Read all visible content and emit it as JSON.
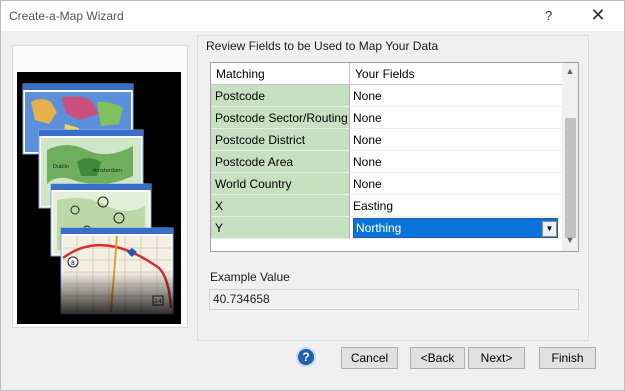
{
  "window": {
    "title": "Create-a-Map Wizard",
    "help_glyph": "?",
    "close_glyph": "✕"
  },
  "panel": {
    "section_title": "Review Fields to be Used to Map Your Data",
    "columns": [
      "Matching",
      "Your Fields"
    ],
    "rows": [
      {
        "matching": "Postcode",
        "field": "None"
      },
      {
        "matching": "Postcode Sector/Routing",
        "field": "None"
      },
      {
        "matching": "Postcode District",
        "field": "None"
      },
      {
        "matching": "Postcode Area",
        "field": "None"
      },
      {
        "matching": "World Country",
        "field": "None"
      },
      {
        "matching": "X",
        "field": "Easting"
      },
      {
        "matching": "Y",
        "field": "Northing"
      }
    ],
    "example_label": "Example Value",
    "example_value": "40.734658"
  },
  "buttons": {
    "help": "?",
    "cancel": "Cancel",
    "back": "<Back",
    "next": "Next>",
    "finish": "Finish"
  },
  "icons": {
    "scroll_up": "up-arrow-icon",
    "scroll_down": "down-arrow-icon",
    "dropdown": "chevron-down-icon"
  },
  "colors": {
    "matching_column": "#c7e0c2",
    "selected_field": "#0a74da",
    "help_button": "#1f5fad"
  }
}
